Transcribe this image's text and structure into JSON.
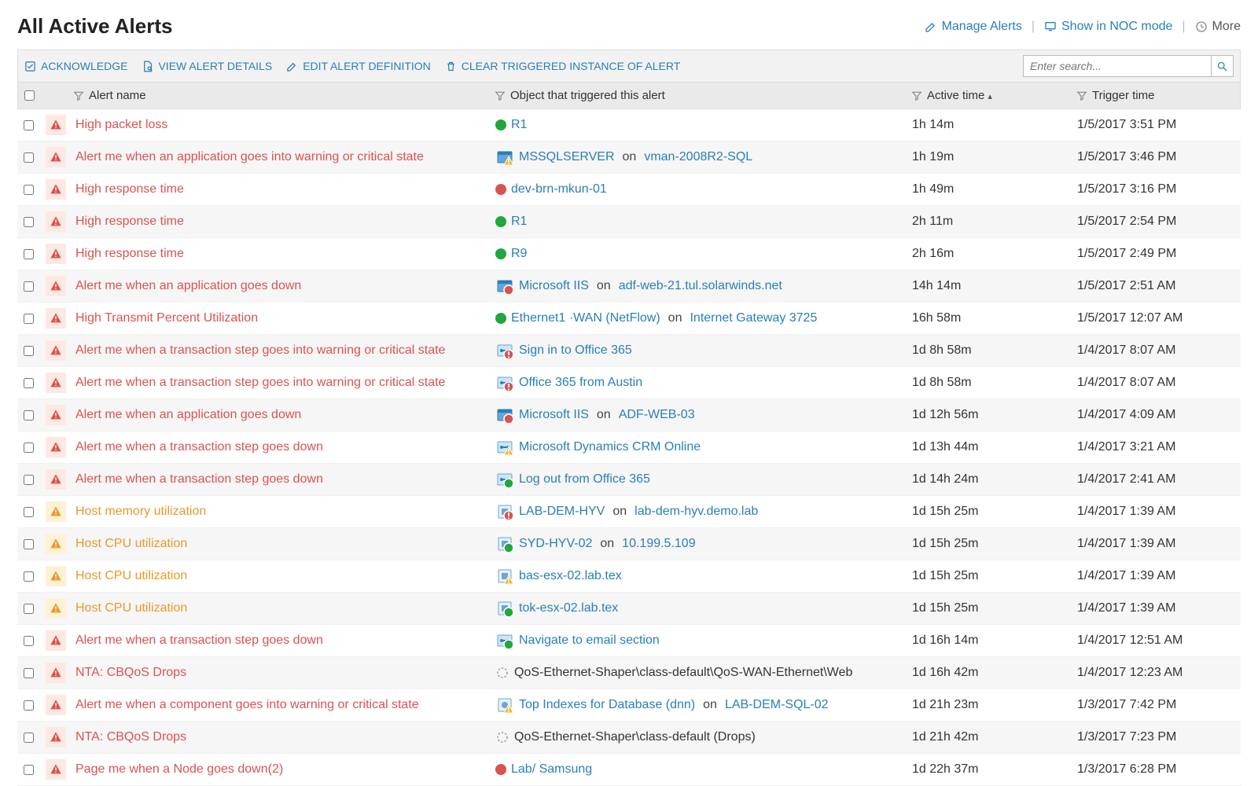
{
  "page": {
    "title": "All Active Alerts"
  },
  "header": {
    "manage_alerts": "Manage Alerts",
    "show_noc": "Show in NOC mode",
    "more": "More"
  },
  "toolbar": {
    "acknowledge": "ACKNOWLEDGE",
    "view_details": "VIEW ALERT DETAILS",
    "edit_definition": "EDIT ALERT DEFINITION",
    "clear_triggered": "CLEAR TRIGGERED INSTANCE OF ALERT",
    "search_placeholder": "Enter search..."
  },
  "columns": {
    "alert_name": "Alert name",
    "object": "Object that triggered this alert",
    "active_time": "Active time",
    "trigger_time": "Trigger time"
  },
  "alerts": [
    {
      "severity": "critical",
      "name": "High packet loss",
      "obj_icon": "dot-up",
      "object": [
        {
          "t": "link",
          "v": "R1"
        }
      ],
      "active": "1h 14m",
      "trigger": "1/5/2017 3:51 PM"
    },
    {
      "severity": "critical",
      "name": "Alert me when an application goes into warning or critical state",
      "obj_icon": "app-warn",
      "object": [
        {
          "t": "link",
          "v": "MSSQLSERVER"
        },
        {
          "t": "on",
          "v": "on"
        },
        {
          "t": "link",
          "v": "vman-2008R2-SQL"
        }
      ],
      "active": "1h 19m",
      "trigger": "1/5/2017 3:46 PM"
    },
    {
      "severity": "critical",
      "name": "High response time",
      "obj_icon": "dot-down",
      "object": [
        {
          "t": "link",
          "v": "dev-brn-mkun-01"
        }
      ],
      "active": "1h 49m",
      "trigger": "1/5/2017 3:16 PM"
    },
    {
      "severity": "critical",
      "name": "High response time",
      "obj_icon": "dot-up",
      "object": [
        {
          "t": "link",
          "v": "R1"
        }
      ],
      "active": "2h 11m",
      "trigger": "1/5/2017 2:54 PM"
    },
    {
      "severity": "critical",
      "name": "High response time",
      "obj_icon": "dot-up",
      "object": [
        {
          "t": "link",
          "v": "R9"
        }
      ],
      "active": "2h 16m",
      "trigger": "1/5/2017 2:49 PM"
    },
    {
      "severity": "critical",
      "name": "Alert me when an application goes down",
      "obj_icon": "app-down",
      "object": [
        {
          "t": "link",
          "v": "Microsoft IIS"
        },
        {
          "t": "on",
          "v": "on"
        },
        {
          "t": "link",
          "v": "adf-web-21.tul.solarwinds.net"
        }
      ],
      "active": "14h 14m",
      "trigger": "1/5/2017 2:51 AM"
    },
    {
      "severity": "critical",
      "name": "High Transmit Percent Utilization",
      "obj_icon": "dot-up",
      "object": [
        {
          "t": "link",
          "v": "Ethernet1 ·WAN (NetFlow)"
        },
        {
          "t": "on",
          "v": "on"
        },
        {
          "t": "link",
          "v": "Internet Gateway 3725"
        }
      ],
      "active": "16h 58m",
      "trigger": "1/5/2017 12:07 AM"
    },
    {
      "severity": "critical",
      "name": "Alert me when a transaction step goes into warning or critical state",
      "obj_icon": "tx-critical",
      "object": [
        {
          "t": "link",
          "v": "Sign in to Office 365"
        }
      ],
      "active": "1d 8h 58m",
      "trigger": "1/4/2017 8:07 AM"
    },
    {
      "severity": "critical",
      "name": "Alert me when a transaction step goes into warning or critical state",
      "obj_icon": "tx-critical",
      "object": [
        {
          "t": "link",
          "v": "Office 365 from Austin"
        }
      ],
      "active": "1d 8h 58m",
      "trigger": "1/4/2017 8:07 AM"
    },
    {
      "severity": "critical",
      "name": "Alert me when an application goes down",
      "obj_icon": "app-down",
      "object": [
        {
          "t": "link",
          "v": "Microsoft IIS"
        },
        {
          "t": "on",
          "v": "on"
        },
        {
          "t": "link",
          "v": "ADF-WEB-03"
        }
      ],
      "active": "1d 12h 56m",
      "trigger": "1/4/2017 4:09 AM"
    },
    {
      "severity": "critical",
      "name": "Alert me when a transaction step goes down",
      "obj_icon": "tx-warn",
      "object": [
        {
          "t": "link",
          "v": "Microsoft Dynamics CRM Online"
        }
      ],
      "active": "1d 13h 44m",
      "trigger": "1/4/2017 3:21 AM"
    },
    {
      "severity": "critical",
      "name": "Alert me when a transaction step goes down",
      "obj_icon": "tx-up",
      "object": [
        {
          "t": "link",
          "v": "Log out from Office 365"
        }
      ],
      "active": "1d 14h 24m",
      "trigger": "1/4/2017 2:41 AM"
    },
    {
      "severity": "warning",
      "name": "Host memory utilization",
      "obj_icon": "vm-critical",
      "object": [
        {
          "t": "link",
          "v": "LAB-DEM-HYV"
        },
        {
          "t": "on",
          "v": "on"
        },
        {
          "t": "link",
          "v": "lab-dem-hyv.demo.lab"
        }
      ],
      "active": "1d 15h 25m",
      "trigger": "1/4/2017 1:39 AM"
    },
    {
      "severity": "warning",
      "name": "Host CPU utilization",
      "obj_icon": "vm-up",
      "object": [
        {
          "t": "link",
          "v": "SYD-HYV-02"
        },
        {
          "t": "on",
          "v": "on"
        },
        {
          "t": "link",
          "v": "10.199.5.109"
        }
      ],
      "active": "1d 15h 25m",
      "trigger": "1/4/2017 1:39 AM"
    },
    {
      "severity": "warning",
      "name": "Host CPU utilization",
      "obj_icon": "vm-warn",
      "object": [
        {
          "t": "link",
          "v": "bas-esx-02.lab.tex"
        }
      ],
      "active": "1d 15h 25m",
      "trigger": "1/4/2017 1:39 AM"
    },
    {
      "severity": "warning",
      "name": "Host CPU utilization",
      "obj_icon": "vm-up",
      "object": [
        {
          "t": "link",
          "v": "tok-esx-02.lab.tex"
        }
      ],
      "active": "1d 15h 25m",
      "trigger": "1/4/2017 1:39 AM"
    },
    {
      "severity": "critical",
      "name": "Alert me when a transaction step goes down",
      "obj_icon": "tx-up",
      "object": [
        {
          "t": "link",
          "v": "Navigate to email section"
        }
      ],
      "active": "1d 16h 14m",
      "trigger": "1/4/2017 12:51 AM"
    },
    {
      "severity": "critical",
      "name": "NTA: CBQoS Drops",
      "obj_icon": "unknown",
      "object": [
        {
          "t": "plain",
          "v": "QoS-Ethernet-Shaper\\class-default\\QoS-WAN-Ethernet\\Web"
        }
      ],
      "active": "1d 16h 42m",
      "trigger": "1/4/2017 12:23 AM"
    },
    {
      "severity": "critical",
      "name": "Alert me when a component goes into warning or critical state",
      "obj_icon": "comp-warn",
      "object": [
        {
          "t": "link",
          "v": "Top Indexes for Database (dnn)"
        },
        {
          "t": "on",
          "v": "on"
        },
        {
          "t": "link",
          "v": "LAB-DEM-SQL-02"
        }
      ],
      "active": "1d 21h 23m",
      "trigger": "1/3/2017 7:42 PM"
    },
    {
      "severity": "critical",
      "name": "NTA: CBQoS Drops",
      "obj_icon": "unknown",
      "object": [
        {
          "t": "plain",
          "v": "QoS-Ethernet-Shaper\\class-default (Drops)"
        }
      ],
      "active": "1d 21h 42m",
      "trigger": "1/3/2017 7:23 PM"
    },
    {
      "severity": "critical",
      "name": "Page me when a Node goes down(2)",
      "obj_icon": "dot-down",
      "object": [
        {
          "t": "link",
          "v": "Lab/ Samsung"
        }
      ],
      "active": "1d 22h 37m",
      "trigger": "1/3/2017 6:28 PM"
    }
  ]
}
